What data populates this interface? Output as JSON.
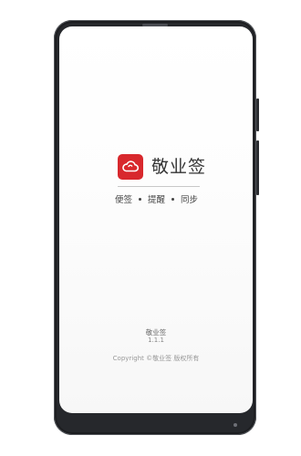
{
  "app": {
    "name": "敬业签",
    "logo_icon": "cloud-icon",
    "brand_color": "#d8282d"
  },
  "taglines": [
    "便签",
    "提醒",
    "同步"
  ],
  "footer": {
    "name": "敬业签",
    "version": "1.1.1",
    "copyright": "Copyright ©敬业签 版权所有"
  }
}
